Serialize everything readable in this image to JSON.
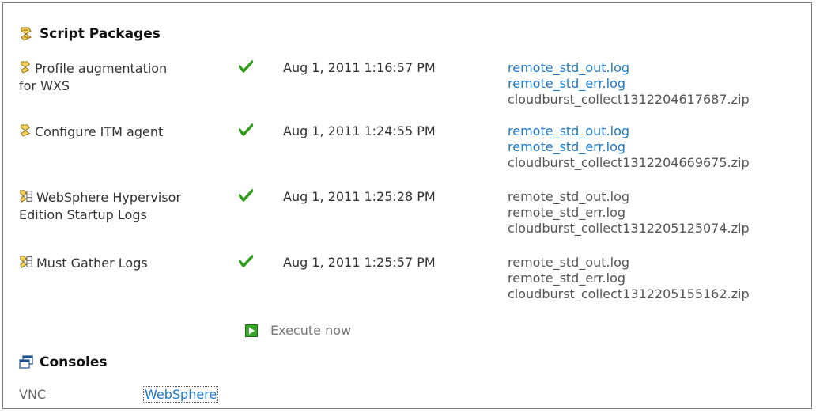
{
  "script_packages": {
    "title": "Script Packages",
    "icon": "script-package-icon",
    "items": [
      {
        "name_line1": "Profile augmentation",
        "name_line2": "for WXS",
        "icon": "script-package-icon",
        "status_icon": "checkmark-icon",
        "timestamp": "Aug 1, 2011 1:16:57 PM",
        "files": [
          "remote_std_out.log",
          "remote_std_err.log",
          "cloudburst_collect1312204617687.zip"
        ],
        "files_link": [
          true,
          true,
          false
        ]
      },
      {
        "name_line1": "Configure ITM agent",
        "name_line2": "",
        "icon": "script-package-icon",
        "status_icon": "checkmark-icon",
        "timestamp": "Aug 1, 2011 1:24:55 PM",
        "files": [
          "remote_std_out.log",
          "remote_std_err.log",
          "cloudburst_collect1312204669675.zip"
        ],
        "files_link": [
          true,
          true,
          false
        ]
      },
      {
        "name_line1": "WebSphere Hypervisor",
        "name_line2": "Edition Startup Logs",
        "icon": "log-package-icon",
        "status_icon": "checkmark-icon",
        "timestamp": "Aug 1, 2011 1:25:28 PM",
        "files": [
          "remote_std_out.log",
          "remote_std_err.log",
          "cloudburst_collect1312205125074.zip"
        ],
        "files_link": [
          false,
          false,
          false
        ]
      },
      {
        "name_line1": "Must Gather Logs",
        "name_line2": "",
        "icon": "log-package-icon",
        "status_icon": "checkmark-icon",
        "timestamp": "Aug 1, 2011 1:25:57 PM",
        "files": [
          "remote_std_out.log",
          "remote_std_err.log",
          "cloudburst_collect1312205155162.zip"
        ],
        "files_link": [
          false,
          false,
          false
        ]
      }
    ],
    "execute_label": "Execute now",
    "execute_icon": "play-icon"
  },
  "consoles": {
    "title": "Consoles",
    "icon": "console-windows-icon",
    "vnc_label": "VNC",
    "websphere_label": "WebSphere"
  },
  "colors": {
    "link": "#1d79c9",
    "check": "#2e9e1a",
    "play": "#3aa82a",
    "text": "#333333"
  }
}
